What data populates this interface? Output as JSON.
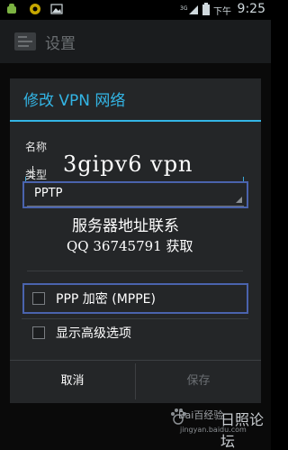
{
  "status_bar": {
    "ampm": "下午",
    "time": "9:25",
    "signal_label": "3G"
  },
  "action_bar": {
    "title": "设置"
  },
  "dialog": {
    "title": "修改 VPN 网络",
    "name_label": "名称",
    "name_value": "",
    "type_label": "类型",
    "type_value": "PPTP",
    "ppp_label": "PPP 加密 (MPPE)",
    "advanced_label": "显示高级选项",
    "cancel_label": "取消",
    "save_label": "保存"
  },
  "overlay": {
    "headline": "3gipv6 vpn",
    "line1": "服务器地址联系",
    "line2": "QQ 36745791 获取"
  },
  "watermark": {
    "logo_text": "日照论坛",
    "baidu_text": "Bai百经验",
    "url_text": "jingyan.baidu.com"
  },
  "colors": {
    "accent": "#33b5e5",
    "highlight_box": "#4a63ad",
    "dialog_bg": "#242628"
  }
}
